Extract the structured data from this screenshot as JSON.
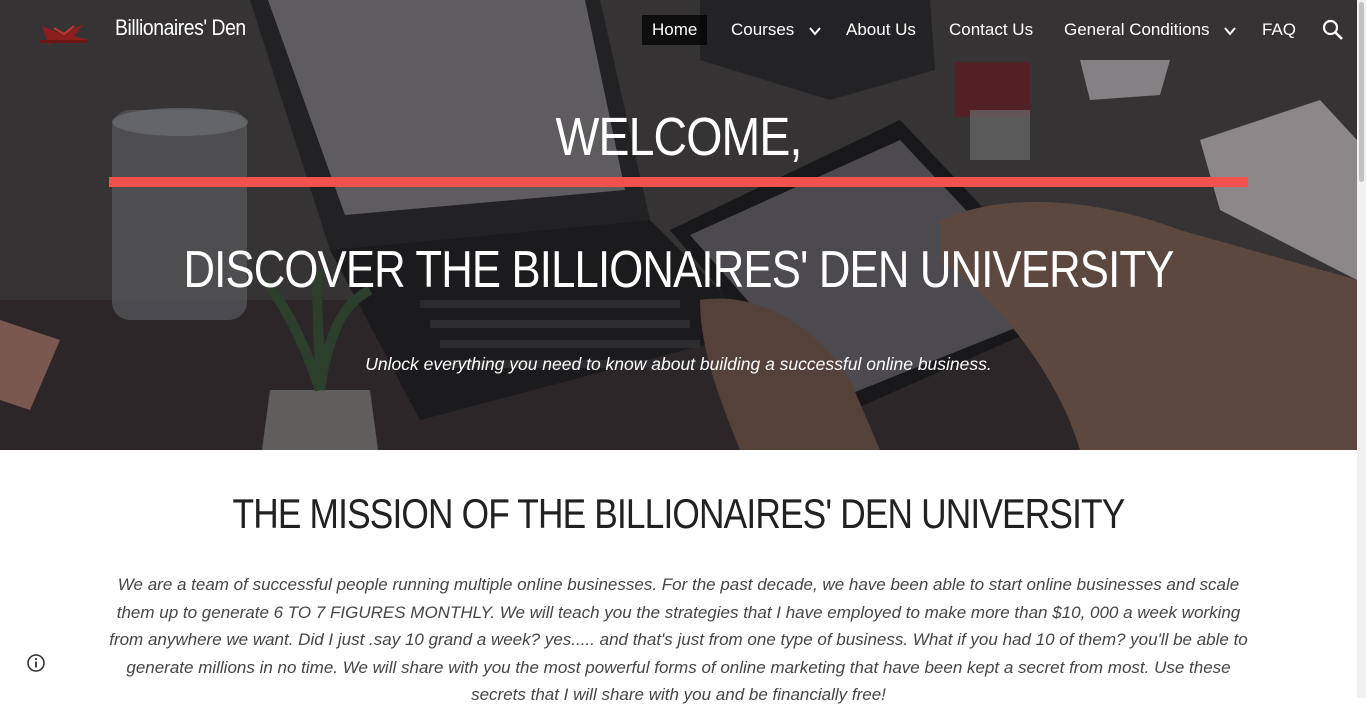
{
  "site": {
    "title": "Billionaires' Den",
    "logo_icon": "logo-icon"
  },
  "nav": {
    "items": [
      {
        "label": "Home",
        "active": true
      },
      {
        "label": "Courses",
        "has_dropdown": true
      },
      {
        "label": "About Us"
      },
      {
        "label": "Contact Us"
      },
      {
        "label": "General Conditions",
        "has_dropdown": true
      },
      {
        "label": "FAQ"
      }
    ],
    "search_icon": "search-icon"
  },
  "hero": {
    "welcome": "WELCOME,",
    "heading": "DISCOVER THE BILLIONAIRES' DEN UNIVERSITY",
    "tagline": "Unlock everything you need to know about building a successful online business.",
    "accent_color": "#f2524f"
  },
  "mission": {
    "title": "THE MISSION OF THE BILLIONAIRES' DEN UNIVERSITY",
    "body": "We are a team of successful people running multiple online businesses. For the past decade, we have been able to start online businesses and scale them up to generate 6 TO 7 FIGURES MONTHLY. We will teach you the strategies that I have employed to make more than $10, 000 a week working from anywhere we want. Did I just .say 10 grand a week? yes..... and that's just from one type of business. What if you had 10 of them?  you'll be able to generate millions in no time. We will share with you the most powerful forms of online marketing that have been kept a secret from most. Use these secrets that I will share with you and be financially free!"
  },
  "footer": {
    "info_icon": "info-icon"
  }
}
